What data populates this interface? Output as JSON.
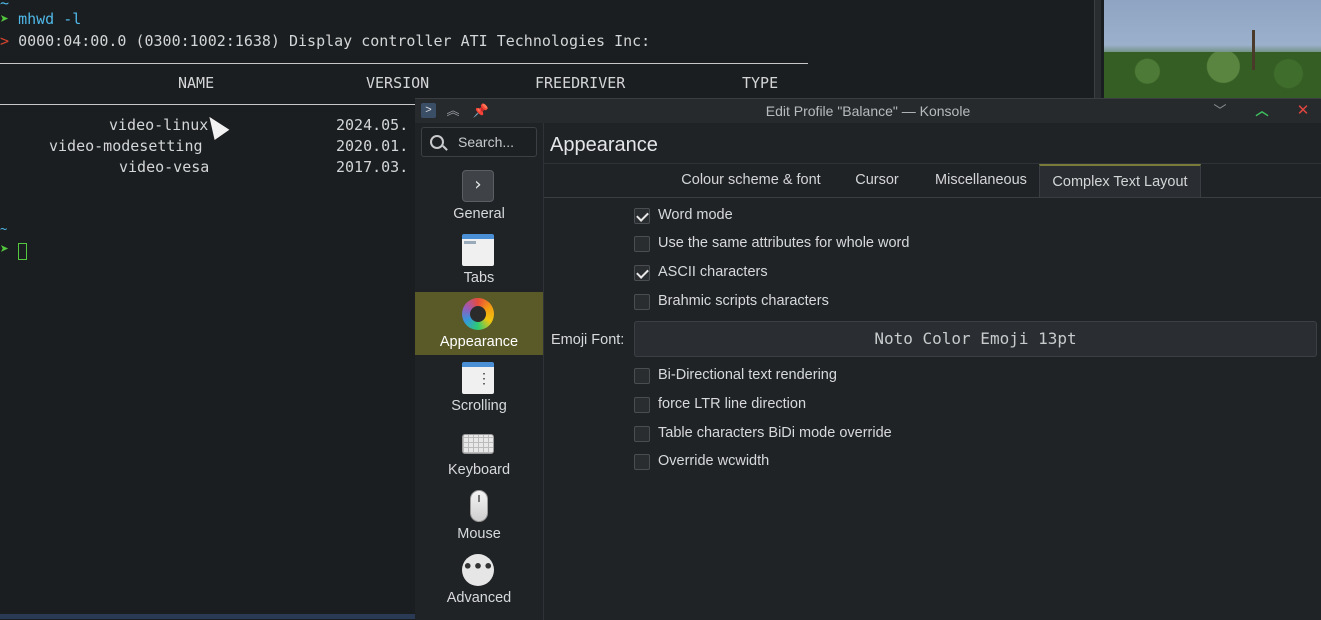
{
  "terminal": {
    "command": "mhwd -l",
    "device_line": "0000:04:00.0 (0300:1002:1638) Display controller ATI Technologies Inc:",
    "columns": [
      "NAME",
      "VERSION",
      "FREEDRIVER",
      "TYPE"
    ],
    "rows": [
      {
        "name": "video-linux",
        "version": "2024.05."
      },
      {
        "name": "video-modesetting",
        "version": "2020.01."
      },
      {
        "name": "video-vesa",
        "version": "2017.03."
      }
    ],
    "prompt_tilde": "~"
  },
  "dialog": {
    "title": "Edit Profile \"Balance\" — Konsole",
    "search_placeholder": "Search...",
    "sidebar": [
      {
        "label": "General",
        "icon": "terminal-icon"
      },
      {
        "label": "Tabs",
        "icon": "tabs-icon"
      },
      {
        "label": "Appearance",
        "icon": "color-wheel-icon",
        "active": true
      },
      {
        "label": "Scrolling",
        "icon": "scrollbar-icon"
      },
      {
        "label": "Keyboard",
        "icon": "keyboard-icon"
      },
      {
        "label": "Mouse",
        "icon": "mouse-icon"
      },
      {
        "label": "Advanced",
        "icon": "more-icon"
      }
    ],
    "page_title": "Appearance",
    "tabs": [
      {
        "label": "Colour scheme & font"
      },
      {
        "label": "Cursor"
      },
      {
        "label": "Miscellaneous"
      },
      {
        "label": "Complex Text Layout",
        "active": true
      }
    ],
    "options_top": [
      {
        "label": "Word mode",
        "checked": true
      },
      {
        "label": "Use the same attributes for whole word",
        "checked": false
      },
      {
        "label": "ASCII characters",
        "checked": true
      },
      {
        "label": "Brahmic scripts characters",
        "checked": false
      }
    ],
    "emoji_font_label": "Emoji Font:",
    "emoji_font_value": "Noto Color Emoji 13pt",
    "options_bottom": [
      {
        "label": "Bi-Directional text rendering",
        "checked": false
      },
      {
        "label": "force LTR line direction",
        "checked": false
      },
      {
        "label": "Table characters BiDi mode override",
        "checked": false
      },
      {
        "label": "Override wcwidth",
        "checked": false
      }
    ]
  },
  "colors": {
    "terminal_bg": "#1b1e20",
    "prompt_green": "#53c73d",
    "command_blue": "#4fb8e8",
    "error_red": "#d6452f",
    "active_nav": "#5a5a28",
    "dialog_bg": "#202326"
  }
}
